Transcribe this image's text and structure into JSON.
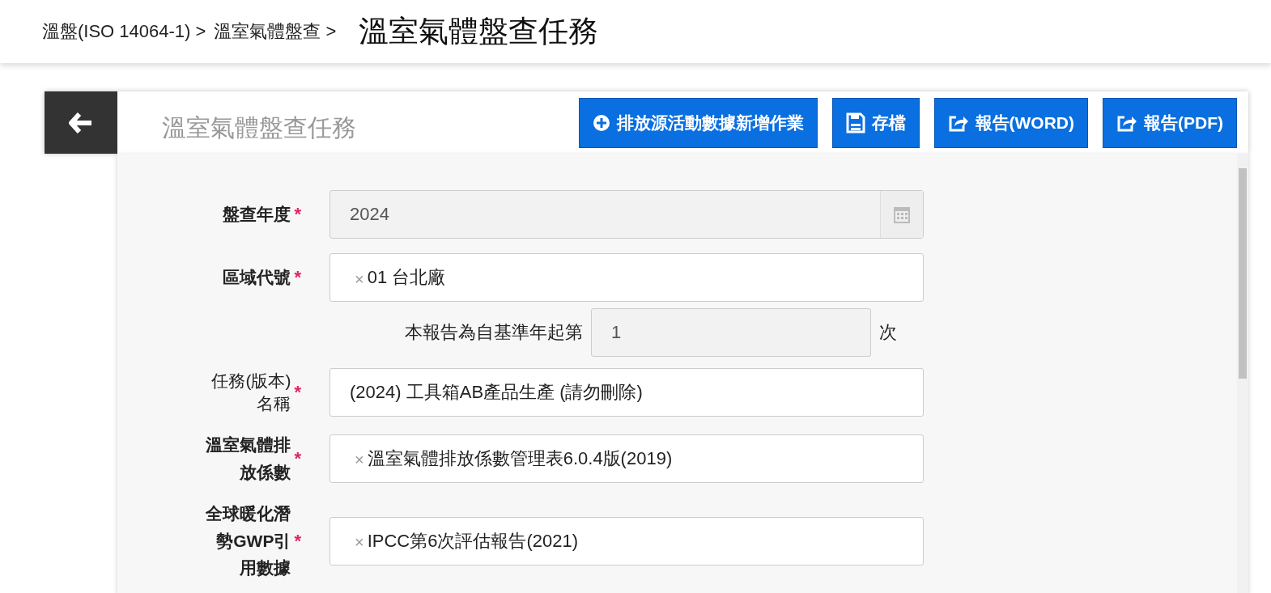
{
  "breadcrumb": {
    "items": [
      "溫盤(ISO 14064-1) >",
      "溫室氣體盤查 >"
    ],
    "current": "溫室氣體盤查任務"
  },
  "panel": {
    "title": "溫室氣體盤查任務",
    "buttons": [
      {
        "label": "排放源活動數據新增作業",
        "kind": "add"
      },
      {
        "label": "存檔",
        "kind": "save"
      },
      {
        "label": "報告(WORD)",
        "kind": "export"
      },
      {
        "label": "報告(PDF)",
        "kind": "export"
      }
    ]
  },
  "form": {
    "fields": [
      {
        "kind": "date",
        "label": "盤查年度",
        "marker": "*",
        "value": "2024"
      },
      {
        "kind": "tags",
        "label": "區域代號",
        "marker": "*",
        "tags": [
          {
            "remove": "×",
            "label": "01 台北廠"
          }
        ]
      },
      {
        "kind": "counter",
        "prefix": "本報告為自基準年起第",
        "value": "1",
        "suffix": "次"
      },
      {
        "kind": "text",
        "label": "任務(版本)名稱",
        "marker": "*",
        "value": "(2024) 工具箱AB產品生產 (請勿刪除)"
      },
      {
        "kind": "tags",
        "label": "溫室氣體排放係數",
        "marker": "*",
        "tags": [
          {
            "remove": "×",
            "label": "溫室氣體排放係數管理表6.0.4版(2019)"
          }
        ]
      },
      {
        "kind": "tags",
        "label": "全球暖化潛勢GWP引用數據",
        "marker": "*",
        "tags": [
          {
            "remove": "×",
            "label": "IPCC第6次評估報告(2021)"
          }
        ]
      }
    ]
  }
}
